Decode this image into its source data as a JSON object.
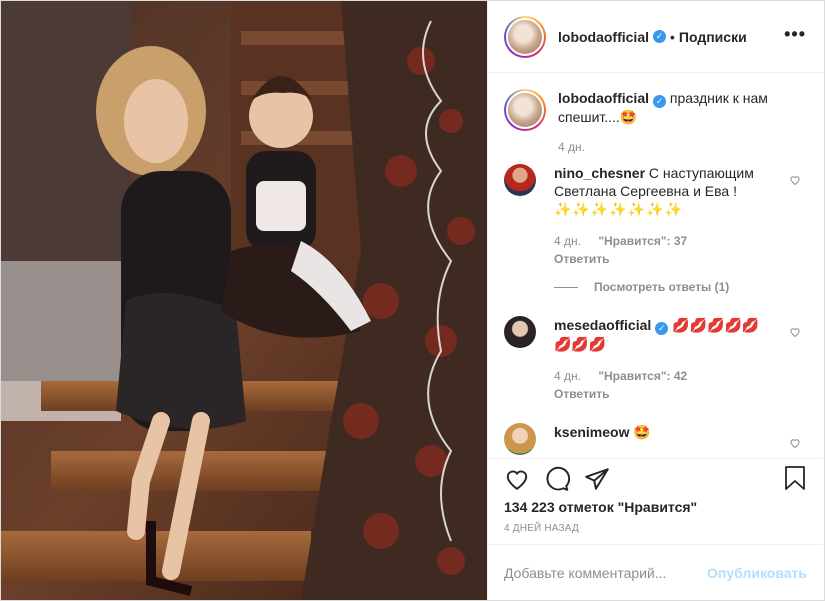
{
  "header": {
    "username": "lobodaofficial",
    "separator": "•",
    "follow_label": "Подписки",
    "more_label": "•••"
  },
  "caption": {
    "username": "lobodaofficial",
    "text": "праздник к нам спешит....",
    "emoji": "🤩",
    "time": "4 дн."
  },
  "comments": [
    {
      "username": "nino_chesner",
      "text": "С наступающим Светлана Сергеевна и Ева !",
      "emoji": "✨✨✨✨✨✨✨",
      "time": "4 дн.",
      "likes": "\"Нравится\": 37",
      "reply": "Ответить",
      "view_replies": "Посмотреть ответы (1)"
    },
    {
      "username": "mesedaofficial",
      "text": "",
      "emoji": "💋💋💋💋💋💋💋💋",
      "time": "4 дн.",
      "likes": "\"Нравится\": 42",
      "reply": "Ответить"
    },
    {
      "username": "ksenimeow",
      "text": "",
      "emoji": "🤩"
    }
  ],
  "actions": {
    "likes_text": "134 223 отметок \"Нравится\"",
    "date": "4 ДНЕЙ НАЗАД"
  },
  "add_comment": {
    "placeholder": "Добавьте комментарий...",
    "publish_label": "Опубликовать"
  },
  "colors": {
    "verified": "#3897f0",
    "publish": "#b2dffc",
    "secondary_text": "#8e8e8e"
  }
}
